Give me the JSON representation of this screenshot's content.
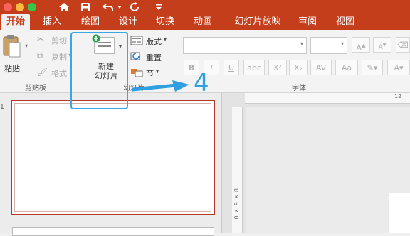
{
  "tabs": [
    "开始",
    "插入",
    "绘图",
    "设计",
    "切换",
    "动画",
    "幻灯片放映",
    "审阅",
    "视图"
  ],
  "clipboard": {
    "paste": "粘贴",
    "cut": "剪切",
    "copy": "复制",
    "format": "格式",
    "group": "剪贴板"
  },
  "slides": {
    "new_line1": "新建",
    "new_line2": "幻灯片",
    "layout": "版式",
    "reset": "重置",
    "section": "节",
    "group": "幻灯片"
  },
  "font": {
    "group": "字体",
    "bold": "B",
    "italic": "I",
    "underline": "U",
    "strike": "abc",
    "superscript": "X²",
    "subscript": "X₂",
    "spacing": "AV",
    "case": "Aa",
    "grow": "A",
    "shrink": "A"
  },
  "annotation": {
    "step": "4"
  },
  "ruler": {
    "h_ticks": "12",
    "v_ticks": "0 ∞ 9 ∞ 8"
  },
  "thumbnail": {
    "number": "1"
  },
  "colors": {
    "accent": "#c43e1c",
    "highlight": "#3aa6e6",
    "selected_border": "#b5382a"
  }
}
